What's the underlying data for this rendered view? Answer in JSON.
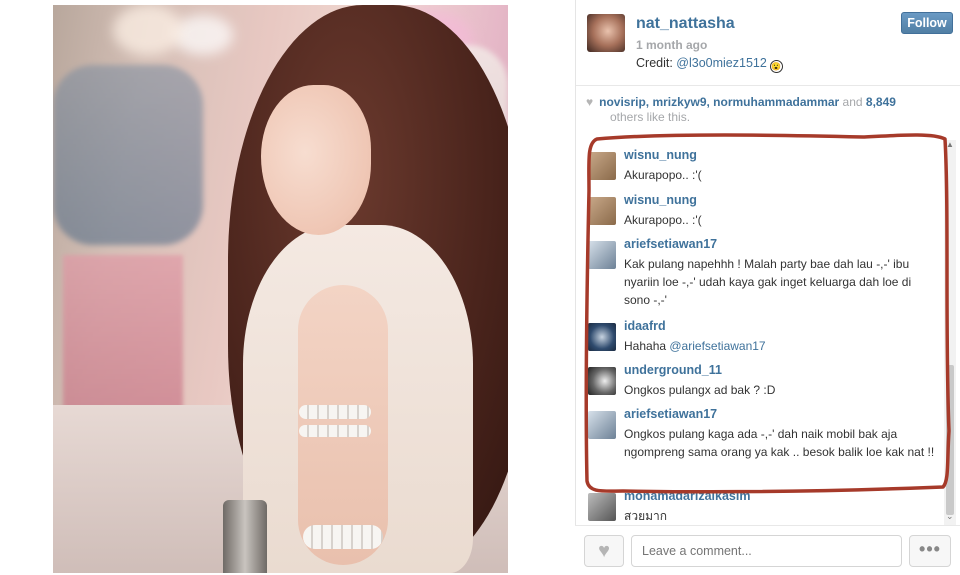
{
  "post": {
    "username": "nat_nattasha",
    "time_ago": "1 month ago",
    "caption_prefix": "Credit: ",
    "caption_mention": "@l3o0miez1512",
    "caption_emoji": "😮",
    "follow_label": "Follow"
  },
  "likes": {
    "heart_icon": "heart-icon",
    "users": "novisrip, mrizkyw9, normuhammadammar",
    "and_text": " and ",
    "count": "8,849",
    "suffix": "others like this."
  },
  "comments": [
    {
      "user": "wisnu_nung",
      "text": "Akurapopo.. :'(",
      "avatar_color": "#a88a6a"
    },
    {
      "user": "wisnu_nung",
      "text": "Akurapopo.. :'(",
      "avatar_color": "#a88a6a"
    },
    {
      "user": "ariefsetiawan17",
      "text": "Kak pulang napehhh ! Malah party bae dah lau -,-' ibu nyariin loe -,-' udah kaya gak inget keluarga dah loe di sono -,-'",
      "avatar_color": "#8aa0b4"
    },
    {
      "user": "idaafrd",
      "text_prefix": "Hahaha ",
      "text_mention": "@ariefsetiawan17",
      "avatar_color": "#2f4b6e"
    },
    {
      "user": "underground_11",
      "text": "Ongkos pulangx ad bak ? :D",
      "avatar_color": "#6a6a6a"
    },
    {
      "user": "ariefsetiawan17",
      "text": "Ongkos pulang kaga ada -,-' dah naik mobil bak aja ngompreng sama orang ya kak .. besok balik loe kak nat !!",
      "avatar_color": "#8aa0b4"
    },
    {
      "user": "mohamadarizalkasim",
      "text": "สวยมาก",
      "avatar_color": "#7a7a7a"
    }
  ],
  "footer": {
    "comment_placeholder": "Leave a comment...",
    "more_label": "•••"
  },
  "colors": {
    "link": "#3f729b",
    "annotation": "#a63a2a"
  }
}
